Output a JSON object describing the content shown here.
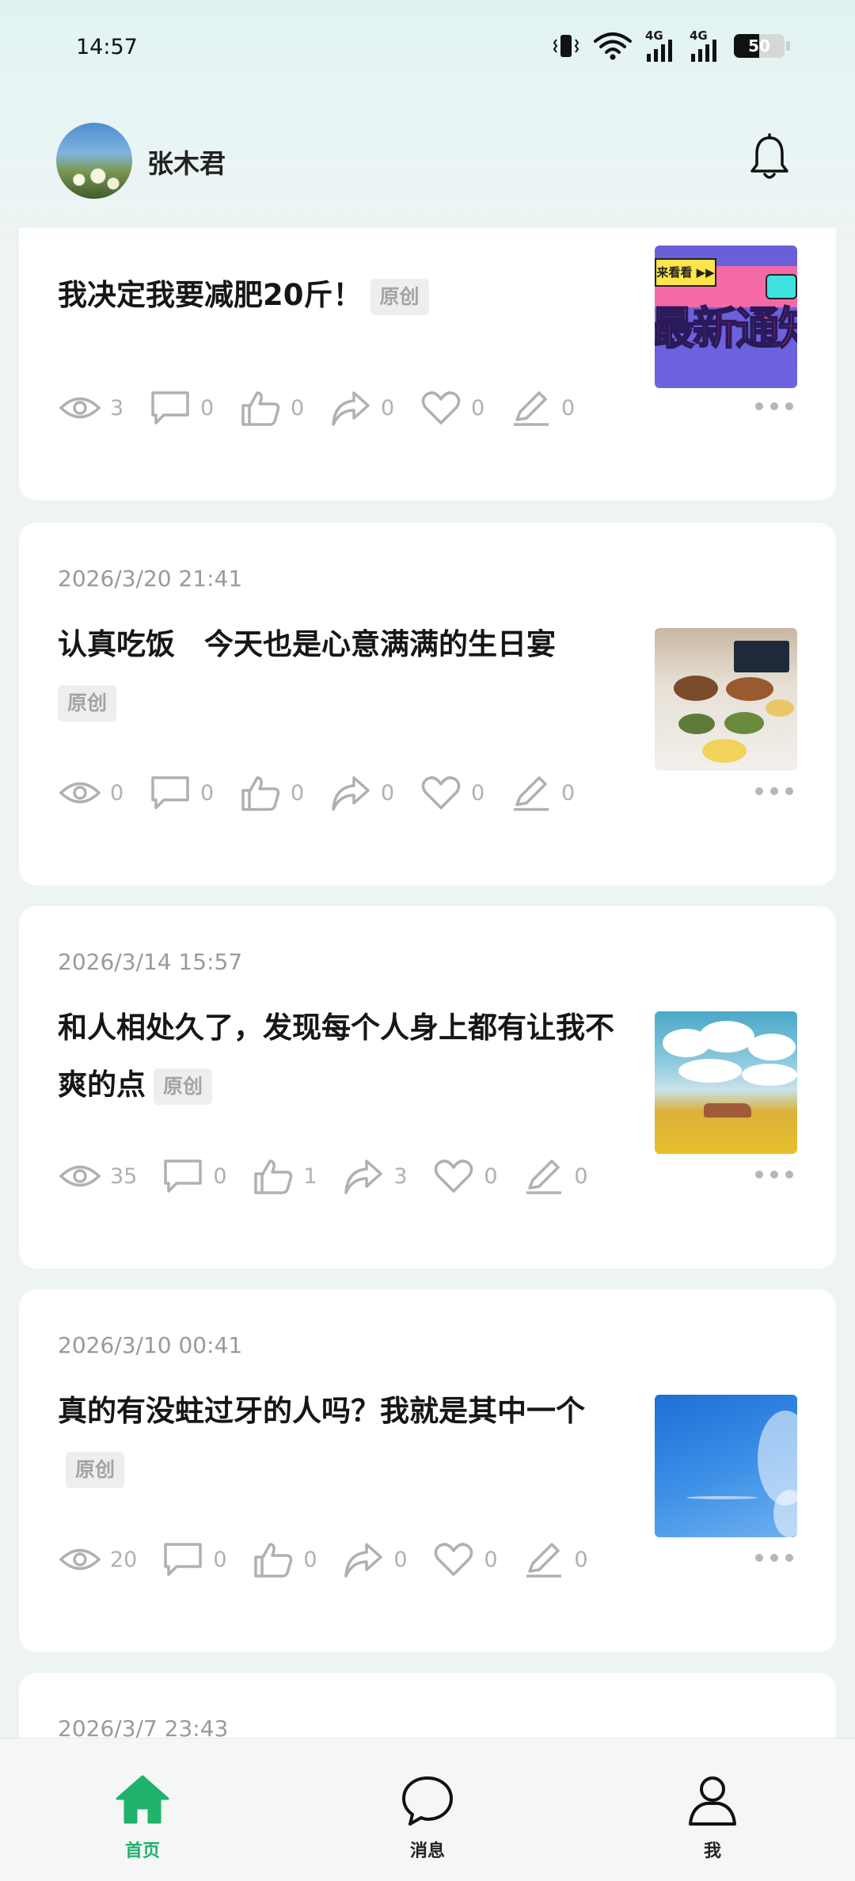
{
  "status": {
    "time": "14:57",
    "battery": "50",
    "net1": "4G",
    "net2": "4G"
  },
  "header": {
    "username": "张木君"
  },
  "posts": [
    {
      "date": "",
      "title": "我决定我要减肥20斤！",
      "tag": "原创",
      "stats": {
        "views": "3",
        "comments": "0",
        "likes": "0",
        "shares": "0",
        "favorites": "0",
        "edits": "0"
      }
    },
    {
      "date": "2026/3/20 21:41",
      "title": "认真吃饭　今天也是心意满满的生日宴",
      "tag": "原创",
      "stats": {
        "views": "0",
        "comments": "0",
        "likes": "0",
        "shares": "0",
        "favorites": "0",
        "edits": "0"
      }
    },
    {
      "date": "2026/3/14 15:57",
      "title": "和人相处久了，发现每个人身上都有让我不爽的点",
      "tag": "原创",
      "stats": {
        "views": "35",
        "comments": "0",
        "likes": "1",
        "shares": "3",
        "favorites": "0",
        "edits": "0"
      }
    },
    {
      "date": "2026/3/10 00:41",
      "title": "真的有没蛀过牙的人吗？我就是其中一个",
      "tag": "原创",
      "stats": {
        "views": "20",
        "comments": "0",
        "likes": "0",
        "shares": "0",
        "favorites": "0",
        "edits": "0"
      }
    },
    {
      "date": "2026/3/7 23:43"
    }
  ],
  "thumb1_text": {
    "button": "来看看 ▶▶",
    "headline": "最新通知"
  },
  "nav": {
    "home": "首页",
    "messages": "消息",
    "me": "我"
  },
  "colors": {
    "accent": "#1fb26a",
    "icon_gray": "#b0b0b0"
  }
}
